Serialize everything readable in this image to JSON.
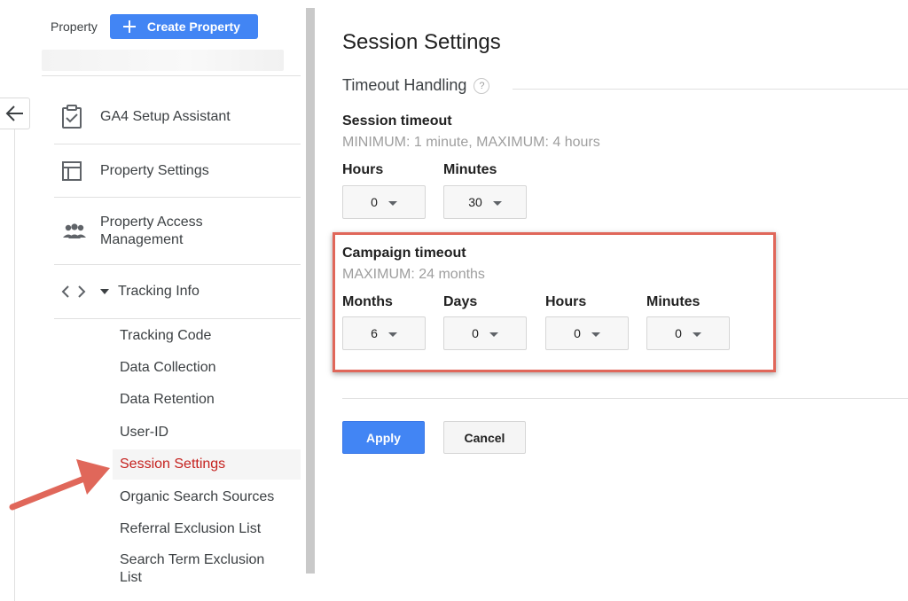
{
  "sidebar": {
    "property_label": "Property",
    "create_button_label": "Create Property",
    "nav_items": [
      {
        "label": "GA4 Setup Assistant",
        "icon": "clipboard-check-icon"
      },
      {
        "label": "Property Settings",
        "icon": "layout-icon"
      },
      {
        "label": "Property Access Management",
        "icon": "people-icon"
      },
      {
        "label": "Tracking Info",
        "icon": "code-icon"
      }
    ],
    "tracking_sub_items": [
      {
        "label": "Tracking Code"
      },
      {
        "label": "Data Collection"
      },
      {
        "label": "Data Retention"
      },
      {
        "label": "User-ID"
      },
      {
        "label": "Session Settings",
        "active": true
      },
      {
        "label": "Organic Search Sources"
      },
      {
        "label": "Referral Exclusion List"
      },
      {
        "label": "Search Term Exclusion List"
      }
    ]
  },
  "main": {
    "title": "Session Settings",
    "section_title": "Timeout Handling",
    "help_symbol": "?",
    "session_timeout": {
      "heading": "Session timeout",
      "note": "MINIMUM: 1 minute, MAXIMUM: 4 hours",
      "hours_label": "Hours",
      "hours_value": "0",
      "minutes_label": "Minutes",
      "minutes_value": "30"
    },
    "campaign_timeout": {
      "heading": "Campaign timeout",
      "note": "MAXIMUM: 24 months",
      "months_label": "Months",
      "months_value": "6",
      "days_label": "Days",
      "days_value": "0",
      "hours_label": "Hours",
      "hours_value": "0",
      "minutes_label": "Minutes",
      "minutes_value": "0"
    },
    "apply_label": "Apply",
    "cancel_label": "Cancel"
  },
  "colors": {
    "brand_blue": "#4285f4",
    "active_text": "#c5221f",
    "highlight_border": "#e0675a"
  }
}
